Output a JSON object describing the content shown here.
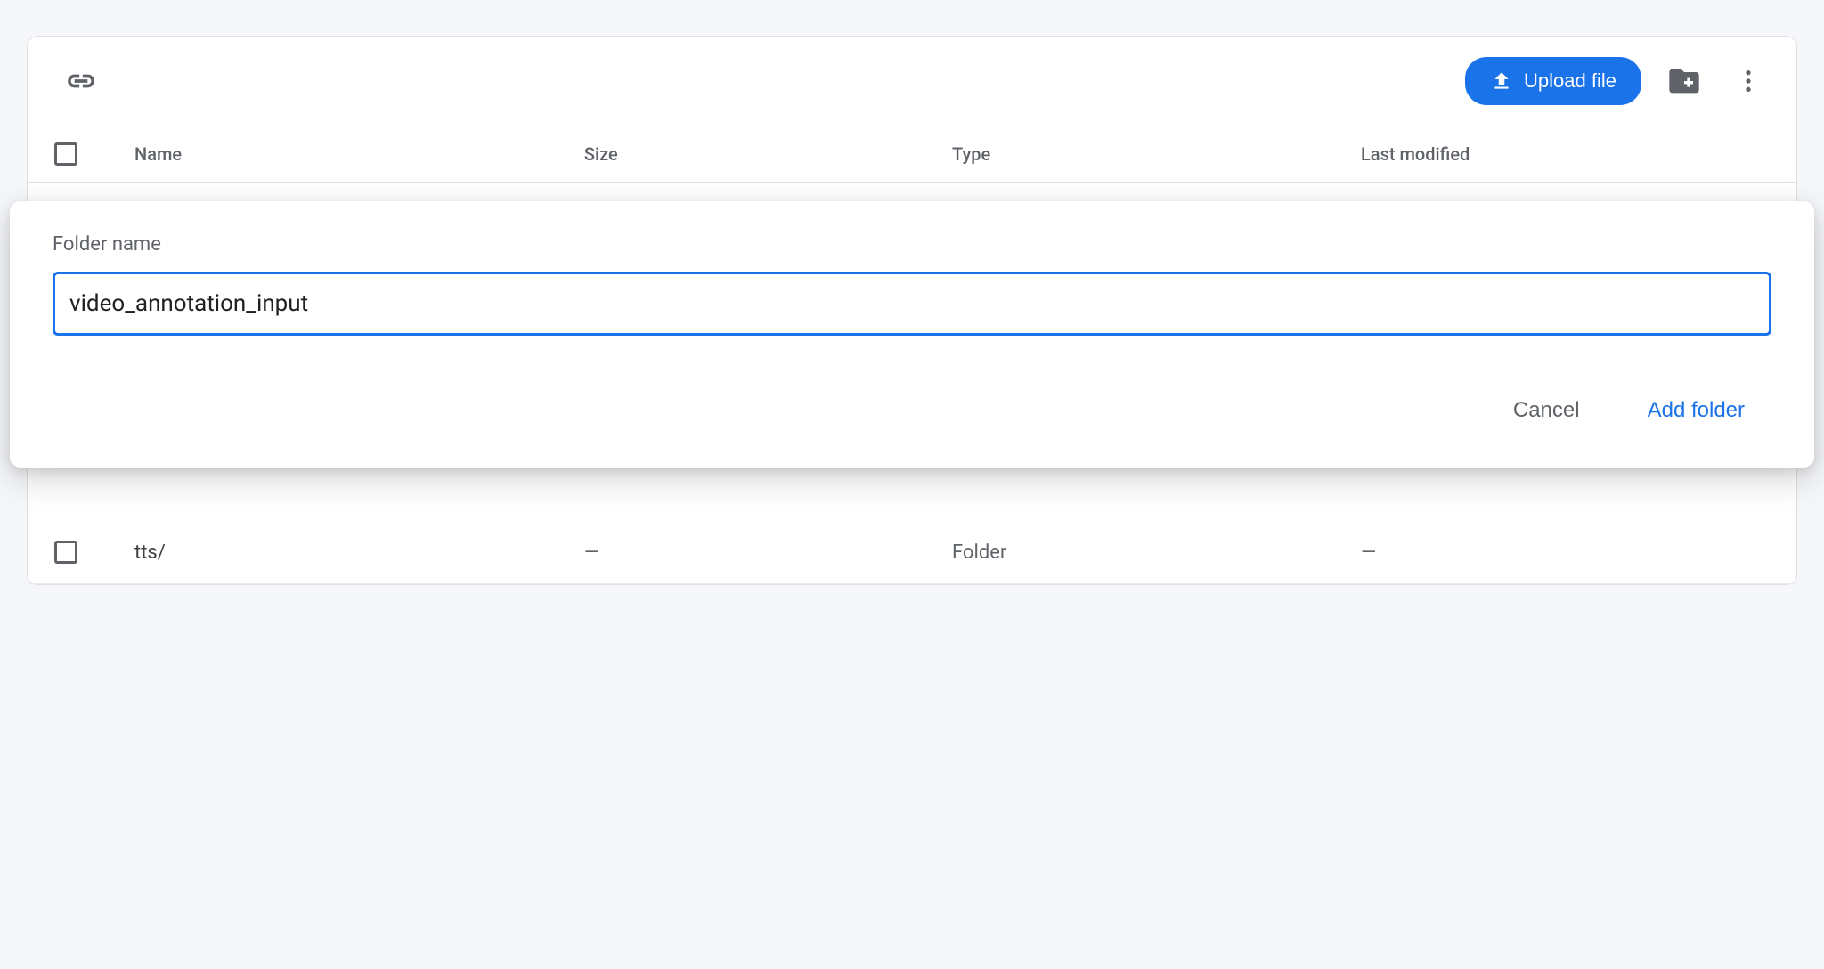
{
  "toolbar": {
    "upload_label": "Upload file"
  },
  "columns": {
    "name": "Name",
    "size": "Size",
    "type": "Type",
    "modified": "Last modified"
  },
  "dialog": {
    "label": "Folder name",
    "value": "video_annotation_input",
    "cancel": "Cancel",
    "confirm": "Add folder"
  },
  "rows": [
    {
      "name": "tts/",
      "size": "—",
      "type": "Folder",
      "modified": "—"
    }
  ]
}
